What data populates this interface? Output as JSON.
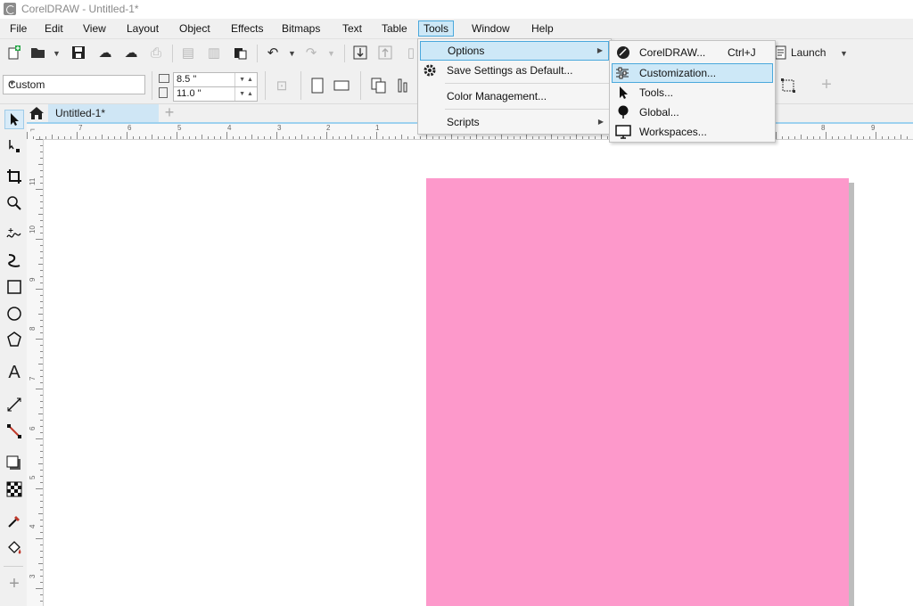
{
  "window": {
    "title": "CorelDRAW - Untitled-1*"
  },
  "menubar": {
    "items": [
      {
        "label": "File"
      },
      {
        "label": "Edit"
      },
      {
        "label": "View"
      },
      {
        "label": "Layout"
      },
      {
        "label": "Object"
      },
      {
        "label": "Effects"
      },
      {
        "label": "Bitmaps"
      },
      {
        "label": "Text"
      },
      {
        "label": "Table"
      },
      {
        "label": "Tools"
      },
      {
        "label": "Window"
      },
      {
        "label": "Help"
      }
    ],
    "active": "Tools"
  },
  "toolbar": {
    "launch_label": "Launch"
  },
  "property_bar": {
    "page_preset": "Custom",
    "width": "8.5 \"",
    "height": "11.0 \""
  },
  "document_tabs": {
    "active_tab": "Untitled-1*"
  },
  "rulers": {
    "horizontal_labels": [
      "7",
      "6",
      "5",
      "4",
      "3",
      "2",
      "1",
      "8",
      "9"
    ],
    "vertical_labels": [
      "11",
      "10",
      "9",
      "8",
      "7",
      "6",
      "5",
      "4",
      "3"
    ]
  },
  "tools_menu": {
    "items": [
      {
        "label": "Options",
        "has_submenu": true,
        "highlighted": true
      },
      {
        "label": "Save Settings as Default...",
        "has_submenu": false
      },
      {
        "label": "Color Management...",
        "has_submenu": false
      },
      {
        "label": "Scripts",
        "has_submenu": true
      }
    ]
  },
  "options_submenu": {
    "items": [
      {
        "label": "CorelDRAW...",
        "shortcut": "Ctrl+J",
        "icon": "coreldraw-icon"
      },
      {
        "label": "Customization...",
        "shortcut": "",
        "icon": "customization-icon",
        "highlighted": true
      },
      {
        "label": "Tools...",
        "shortcut": "",
        "icon": "pointer-icon"
      },
      {
        "label": "Global...",
        "shortcut": "",
        "icon": "globe-icon"
      },
      {
        "label": "Workspaces...",
        "shortcut": "",
        "icon": "monitor-icon"
      }
    ]
  },
  "colors": {
    "page_fill": "#fd99cb",
    "highlight": "#cde8f7",
    "highlight_border": "#4aa8dc"
  }
}
